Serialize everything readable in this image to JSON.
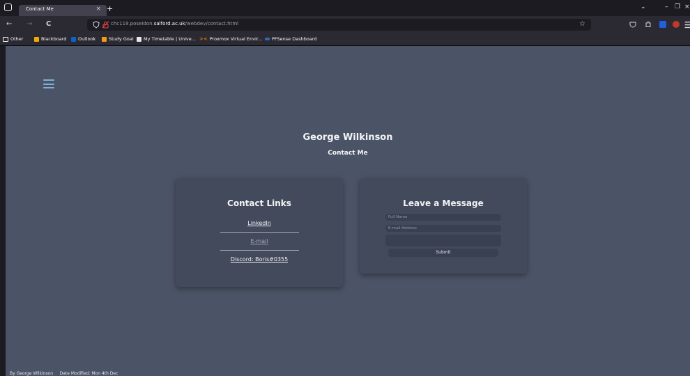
{
  "browser": {
    "tab_title": "Contact Me",
    "tab_close": "×",
    "new_tab": "+",
    "url_prefix": "chc119.poseidon.",
    "url_host": "salford.ac.uk",
    "url_path": "/webdev/contact.html",
    "window_controls": {
      "dropdown": "⌄",
      "minimize": "–",
      "restore": "❐",
      "close": "×"
    },
    "nav": {
      "back": "←",
      "forward": "→",
      "reload": "C"
    }
  },
  "bookmarks": [
    {
      "label": "Other",
      "icon": "folder-icon",
      "color": "#fbfbfe"
    },
    {
      "label": "Blackboard",
      "icon": "blackboard-icon",
      "color": "#f2a900"
    },
    {
      "label": "Outlook",
      "icon": "outlook-icon",
      "color": "#0a64c8"
    },
    {
      "label": "Study Goal",
      "icon": "study-goal-icon",
      "color": "#f39c12"
    },
    {
      "label": "My Timetable | Unive...",
      "icon": "timetable-icon",
      "color": "#e6e8ec"
    },
    {
      "label": "Proxmox Virtual Envir...",
      "icon": "proxmox-icon",
      "color": "#e57000"
    },
    {
      "label": "PFSense Dashboard",
      "icon": "pfsense-icon",
      "color": "#2d6ab3"
    }
  ],
  "site": {
    "name": "George Wilkinson",
    "page": "Contact Me"
  },
  "contact_links": {
    "title": "Contact Links",
    "linkedin": "LinkedIn",
    "email": "E-mail",
    "discord": "Discord: Boris#0355"
  },
  "message_form": {
    "title": "Leave a Message",
    "name_placeholder": "Full Name",
    "email_placeholder": "E-mail Address",
    "message_placeholder": "",
    "submit_label": "Submit"
  },
  "footer": {
    "author": "By George Wilkinson",
    "modified": "Date Modified: Mon 4th Dec"
  },
  "colors": {
    "page_bg": "#4b5366",
    "card_bg": "#434a5b",
    "field_bg": "#384052",
    "menu_accent": "#7fb0d8"
  }
}
